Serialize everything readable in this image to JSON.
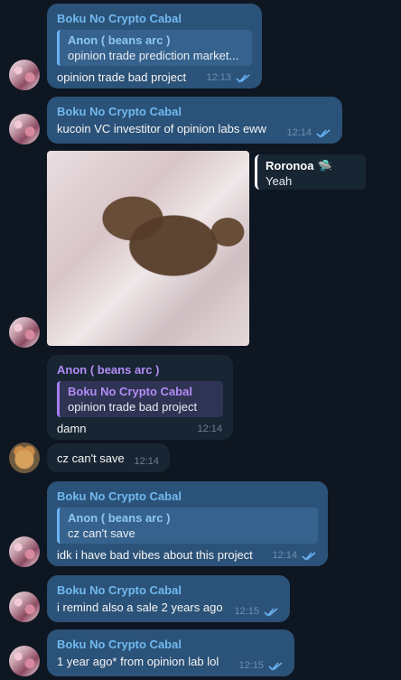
{
  "messages": {
    "m1": {
      "sender": "Boku No Crypto Cabal",
      "reply_name": "Anon ( beans arc )",
      "reply_text": "opinion trade prediction market...",
      "text": "opinion trade bad project",
      "time": "12:13"
    },
    "m2": {
      "sender": "Boku No Crypto Cabal",
      "text": "kucoin VC investitor of opinion labs eww",
      "time": "12:14"
    },
    "m3": {
      "reply_name": "Roronoa",
      "reply_emoji": "🛸",
      "reply_text": "Yeah"
    },
    "m4": {
      "sender": "Anon ( beans arc )",
      "reply_name": "Boku No Crypto Cabal",
      "reply_text": "opinion trade bad project",
      "text": "damn",
      "time": "12:14"
    },
    "m5": {
      "text": "cz can't save",
      "time": "12:14"
    },
    "m6": {
      "sender": "Boku No Crypto Cabal",
      "reply_name": "Anon ( beans arc )",
      "reply_text": "cz can't save",
      "text": "idk i have bad vibes about this project",
      "time": "12:14"
    },
    "m7": {
      "sender": "Boku No Crypto Cabal",
      "text": "i remind also a sale 2 years ago",
      "time": "12:15"
    },
    "m8": {
      "sender": "Boku No Crypto Cabal",
      "text": "1 year ago* from opinion lab lol",
      "time": "12:15"
    }
  },
  "colors": {
    "background": "#0e1621",
    "outgoing_bubble": "#2b5278",
    "incoming_bubble": "#182533",
    "sender_cyan": "#71b9ef",
    "sender_purple": "#b28cf6"
  }
}
